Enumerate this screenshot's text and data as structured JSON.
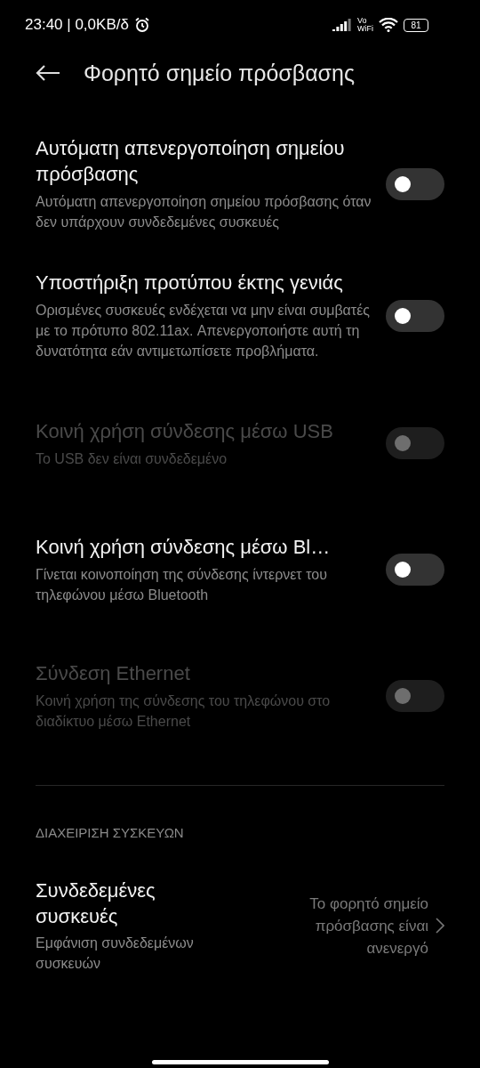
{
  "status_bar": {
    "time": "23:40 | 0,0KB/δ",
    "vowifi_top": "Vo",
    "vowifi_bottom": "WiFi",
    "battery": "81"
  },
  "header": {
    "title": "Φορητό σημείο πρόσβασης"
  },
  "settings": [
    {
      "title": "Αυτόματη απενεργοποίηση σημείου πρόσβασης",
      "subtitle": "Αυτόματη απενεργοποίηση σημείου πρόσβασης όταν δεν υπάρχουν συνδεδεμένες συσκευές",
      "on": false,
      "disabled": false
    },
    {
      "title": "Υποστήριξη προτύπου έκτης γενιάς",
      "subtitle": "Ορισμένες συσκευές ενδέχεται να μην είναι συμβατές με το πρότυπο 802.11ax. Απενεργοποιήστε αυτή τη δυνατότητα εάν αντιμετωπίσετε προβλήματα.",
      "on": false,
      "disabled": false
    },
    {
      "title": "Κοινή χρήση σύνδεσης μέσω USB",
      "subtitle": "Το USB δεν είναι συνδεδεμένο",
      "on": false,
      "disabled": true
    },
    {
      "title": "Κοινή χρήση σύνδεσης μέσω Bl…",
      "subtitle": "Γίνεται κοινοποίηση της σύνδεσης ίντερνετ του τηλεφώνου μέσω Bluetooth",
      "on": false,
      "disabled": false
    },
    {
      "title": "Σύνδεση Ethernet",
      "subtitle": "Κοινή χρήση της σύνδεσης του τηλεφώνου στο διαδίκτυο μέσω Ethernet",
      "on": false,
      "disabled": true
    }
  ],
  "section": {
    "heading": "ΔΙΑΧΕΙΡΙΣΗ ΣΥΣΚΕΥΩΝ",
    "item": {
      "title": "Συνδεδεμένες συσκευές",
      "subtitle": "Εμφάνιση συνδεδεμένων συσκευών",
      "value": "Το φορητό σημείο πρόσβασης είναι ανενεργό"
    }
  }
}
